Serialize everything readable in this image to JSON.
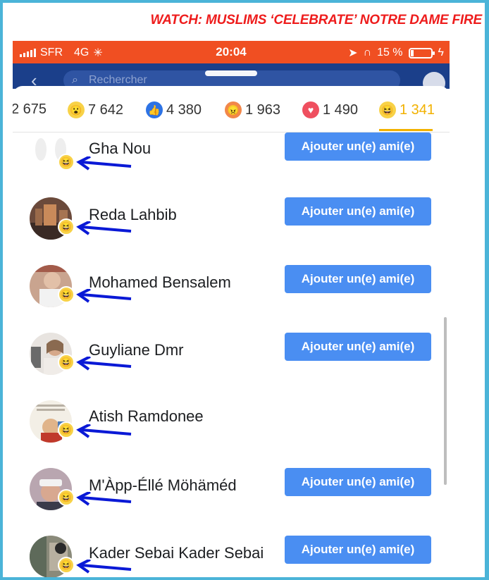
{
  "headline": "WATCH: MUSLIMS ‘CELEBRATE’ NOTRE DAME FIRE",
  "status": {
    "carrier": "SFR",
    "network": "4G",
    "time": "20:04",
    "battery": "15 %"
  },
  "navbar": {
    "search_placeholder": "Rechercher"
  },
  "reaction_tabs": [
    {
      "icon": "haha-icon",
      "count": "2 675"
    },
    {
      "icon": "wow-icon",
      "count": "7 642"
    },
    {
      "icon": "like-icon",
      "count": "4 380"
    },
    {
      "icon": "angry-icon",
      "count": "1 963"
    },
    {
      "icon": "love-icon",
      "count": "1 490"
    },
    {
      "icon": "haha-icon",
      "count": "1 341",
      "active": true
    }
  ],
  "people": [
    {
      "name": "Gha Nou",
      "button": "Ajouter un(e) ami(e)"
    },
    {
      "name": "Reda Lahbib",
      "button": "Ajouter un(e) ami(e)"
    },
    {
      "name": "Mohamed Bensalem",
      "button": "Ajouter un(e) ami(e)"
    },
    {
      "name": "Guyliane Dmr",
      "button": "Ajouter un(e) ami(e)"
    },
    {
      "name": "Atish Ramdonee",
      "button": ""
    },
    {
      "name": "M'Àpp-Éllé Möhäméd",
      "button": "Ajouter un(e) ami(e)"
    },
    {
      "name": "Kader Sebai Kader Sebai",
      "button": "Ajouter un(e) ami(e)"
    }
  ],
  "colors": {
    "frame": "#4bb4d8",
    "headline": "#ee1c1c",
    "statusbar": "#f04f22",
    "navbar": "#1b3f8a",
    "button": "#4a8ef2",
    "active_tab": "#f2b100",
    "annotation_arrow": "#0a19d6"
  }
}
